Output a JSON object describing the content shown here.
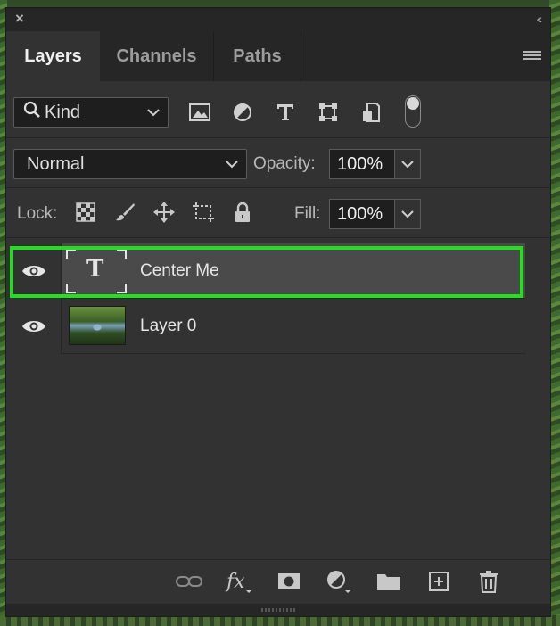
{
  "window": {
    "close_symbol": "×",
    "collapse_symbol": "‹‹"
  },
  "tabs": [
    {
      "label": "Layers",
      "active": true
    },
    {
      "label": "Channels",
      "active": false
    },
    {
      "label": "Paths",
      "active": false
    }
  ],
  "filter": {
    "kind_label": "Kind",
    "icons": [
      "pixel-layer-filter-icon",
      "adjustment-layer-filter-icon",
      "type-layer-filter-icon",
      "shape-layer-filter-icon",
      "smart-object-filter-icon"
    ]
  },
  "blend": {
    "mode": "Normal",
    "opacity_label": "Opacity:",
    "opacity_value": "100%"
  },
  "lock": {
    "label": "Lock:",
    "fill_label": "Fill:",
    "fill_value": "100%"
  },
  "layers": [
    {
      "name": "Center Me",
      "type": "text",
      "thumb_glyph": "T",
      "selected": true,
      "visible": true
    },
    {
      "name": "Layer 0",
      "type": "image",
      "selected": false,
      "visible": true
    }
  ],
  "colors": {
    "panel_bg": "#323232",
    "selection_outline": "#22e01f"
  }
}
